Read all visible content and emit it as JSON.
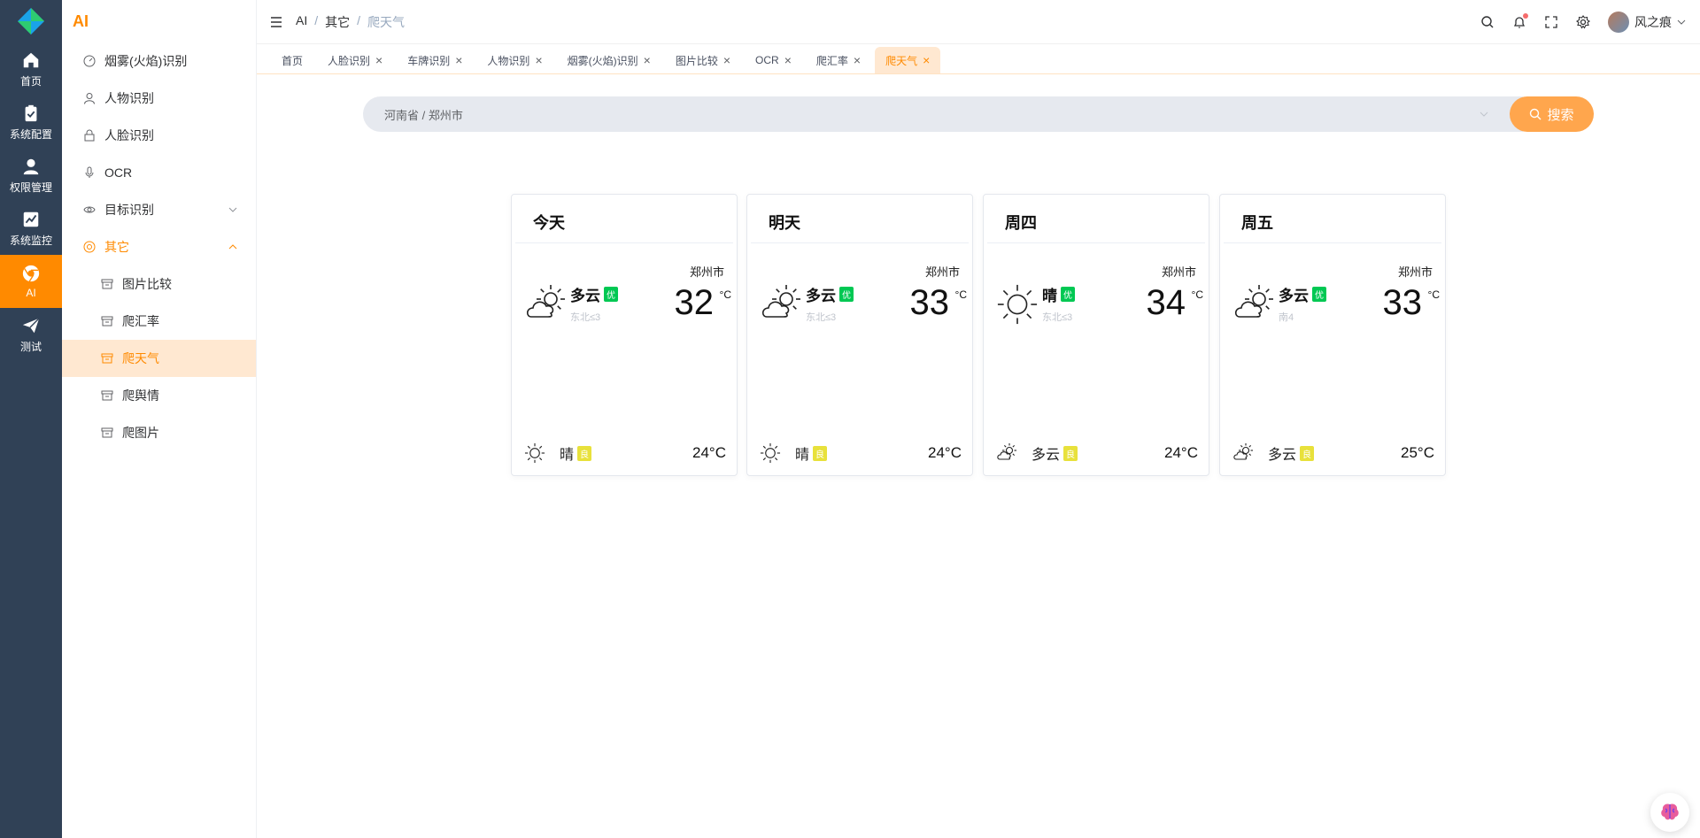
{
  "rail": {
    "items": [
      {
        "label": "首页",
        "icon": "home-icon"
      },
      {
        "label": "系统配置",
        "icon": "clipboard-icon"
      },
      {
        "label": "权限管理",
        "icon": "user-icon"
      },
      {
        "label": "系统监控",
        "icon": "chart-icon"
      },
      {
        "label": "AI",
        "icon": "chrome-icon"
      },
      {
        "label": "测试",
        "icon": "send-icon"
      }
    ],
    "active_color": "#ff8a00",
    "bg_color": "#304156"
  },
  "sidebar": {
    "title": "AI",
    "items": [
      {
        "label": "烟雾(火焰)识别",
        "icon": "gauge-icon"
      },
      {
        "label": "人物识别",
        "icon": "person-icon"
      },
      {
        "label": "人脸识别",
        "icon": "lock-icon"
      },
      {
        "label": "OCR",
        "icon": "mic-icon"
      },
      {
        "label": "目标识别",
        "icon": "eye-icon"
      },
      {
        "label": "其它",
        "icon": "chrome-icon"
      }
    ],
    "sub_items": [
      {
        "label": "图片比较"
      },
      {
        "label": "爬汇率"
      },
      {
        "label": "爬天气"
      },
      {
        "label": "爬舆情"
      },
      {
        "label": "爬图片"
      }
    ]
  },
  "header": {
    "breadcrumb": [
      "AI",
      "其它",
      "爬天气"
    ],
    "user_name": "风之痕"
  },
  "tags": [
    "首页",
    "人脸识别",
    "车牌识别",
    "人物识别",
    "烟雾(火焰)识别",
    "图片比较",
    "OCR",
    "爬汇率",
    "爬天气"
  ],
  "search": {
    "value": "河南省 / 郑州市",
    "button": "搜索"
  },
  "cards": [
    {
      "title": "今天",
      "city": "郑州市",
      "desc": "多云",
      "aqi": "优",
      "wind": "东北≤3",
      "temp": "32",
      "unit": "°C",
      "night_desc": "晴",
      "night_aqi": "良",
      "low": "24°C",
      "icon": "partly-cloudy-icon",
      "night_icon": "sun-icon"
    },
    {
      "title": "明天",
      "city": "郑州市",
      "desc": "多云",
      "aqi": "优",
      "wind": "东北≤3",
      "temp": "33",
      "unit": "°C",
      "night_desc": "晴",
      "night_aqi": "良",
      "low": "24°C",
      "icon": "partly-cloudy-icon",
      "night_icon": "sun-icon"
    },
    {
      "title": "周四",
      "city": "郑州市",
      "desc": "晴",
      "aqi": "优",
      "wind": "东北≤3",
      "temp": "34",
      "unit": "°C",
      "night_desc": "多云",
      "night_aqi": "良",
      "low": "24°C",
      "icon": "sun-icon",
      "night_icon": "partly-cloudy-icon"
    },
    {
      "title": "周五",
      "city": "郑州市",
      "desc": "多云",
      "aqi": "优",
      "wind": "南4",
      "temp": "33",
      "unit": "°C",
      "night_desc": "多云",
      "night_aqi": "良",
      "low": "25°C",
      "icon": "partly-cloudy-icon",
      "night_icon": "partly-cloudy-icon"
    }
  ]
}
